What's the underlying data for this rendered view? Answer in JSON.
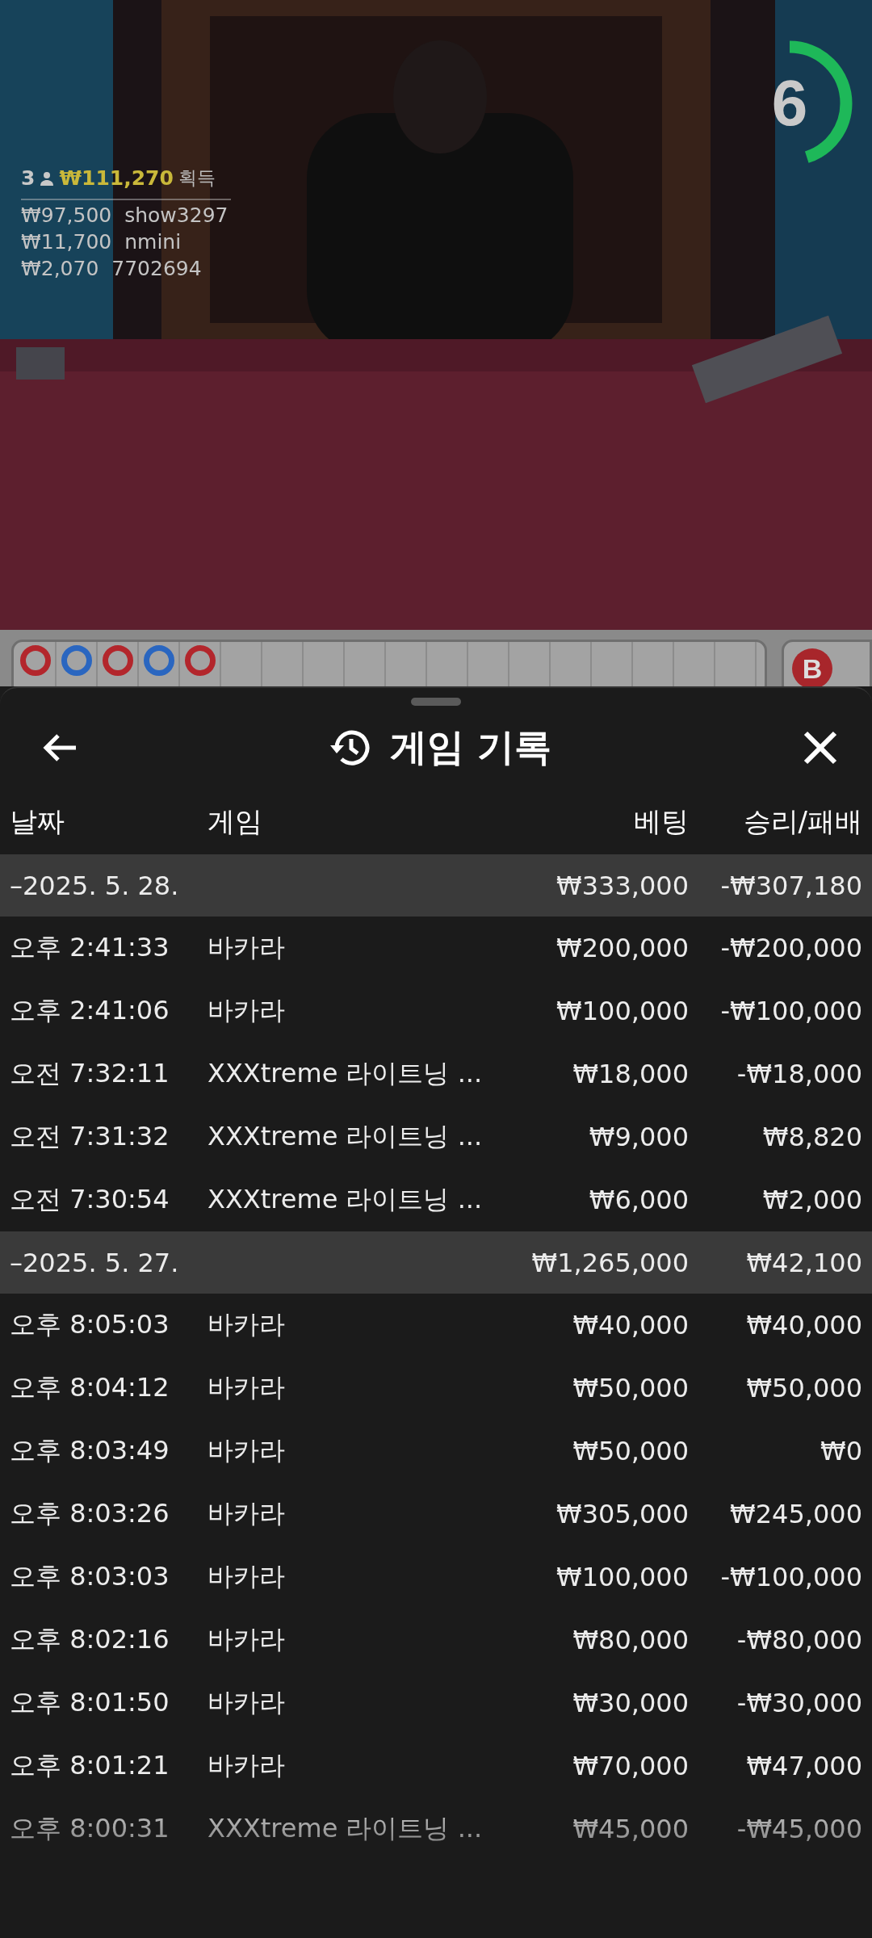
{
  "video": {
    "kind": "picture",
    "timer": {
      "value": "6",
      "level": 0.45
    },
    "winners": {
      "count": "3",
      "total": "₩111,270",
      "label": "획득",
      "list": [
        {
          "amount": "₩97,500",
          "name": "show3297"
        },
        {
          "amount": "₩11,700",
          "name": "nmini"
        },
        {
          "amount": "₩2,070",
          "name": "7702694"
        }
      ]
    }
  },
  "bead_road": {
    "beads": [
      {
        "color": "#b3262c"
      },
      {
        "color": "#2a66c0"
      },
      {
        "color": "#b3262c"
      },
      {
        "color": "#2a66c0"
      },
      {
        "color": "#b3262c"
      }
    ],
    "badge": "B"
  },
  "sheet": {
    "title": "게임 기록",
    "columns": [
      "날짜",
      "게임",
      "베팅",
      "승리/패배"
    ],
    "groups": [
      {
        "date": "–2025. 5. 28.",
        "bet": "₩333,000",
        "result": "-₩307,180",
        "rows": [
          {
            "time": "오후 2:41:33",
            "game": "바카라",
            "bet": "₩200,000",
            "result": "-₩200,000"
          },
          {
            "time": "오후 2:41:06",
            "game": "바카라",
            "bet": "₩100,000",
            "result": "-₩100,000"
          },
          {
            "time": "오전 7:32:11",
            "game": "XXXtreme 라이트닝 ...",
            "bet": "₩18,000",
            "result": "-₩18,000"
          },
          {
            "time": "오전 7:31:32",
            "game": "XXXtreme 라이트닝 ...",
            "bet": "₩9,000",
            "result": "₩8,820"
          },
          {
            "time": "오전 7:30:54",
            "game": "XXXtreme 라이트닝 ...",
            "bet": "₩6,000",
            "result": "₩2,000"
          }
        ]
      },
      {
        "date": "–2025. 5. 27.",
        "bet": "₩1,265,000",
        "result": "₩42,100",
        "rows": [
          {
            "time": "오후 8:05:03",
            "game": "바카라",
            "bet": "₩40,000",
            "result": "₩40,000"
          },
          {
            "time": "오후 8:04:12",
            "game": "바카라",
            "bet": "₩50,000",
            "result": "₩50,000"
          },
          {
            "time": "오후 8:03:49",
            "game": "바카라",
            "bet": "₩50,000",
            "result": "₩0"
          },
          {
            "time": "오후 8:03:26",
            "game": "바카라",
            "bet": "₩305,000",
            "result": "₩245,000"
          },
          {
            "time": "오후 8:03:03",
            "game": "바카라",
            "bet": "₩100,000",
            "result": "-₩100,000"
          },
          {
            "time": "오후 8:02:16",
            "game": "바카라",
            "bet": "₩80,000",
            "result": "-₩80,000"
          },
          {
            "time": "오후 8:01:50",
            "game": "바카라",
            "bet": "₩30,000",
            "result": "-₩30,000"
          },
          {
            "time": "오후 8:01:21",
            "game": "바카라",
            "bet": "₩70,000",
            "result": "₩47,000"
          },
          {
            "time": "오후 8:00:31",
            "game": "XXXtreme 라이트닝 ...",
            "bet": "₩45,000",
            "result": "-₩45,000"
          }
        ]
      }
    ]
  }
}
